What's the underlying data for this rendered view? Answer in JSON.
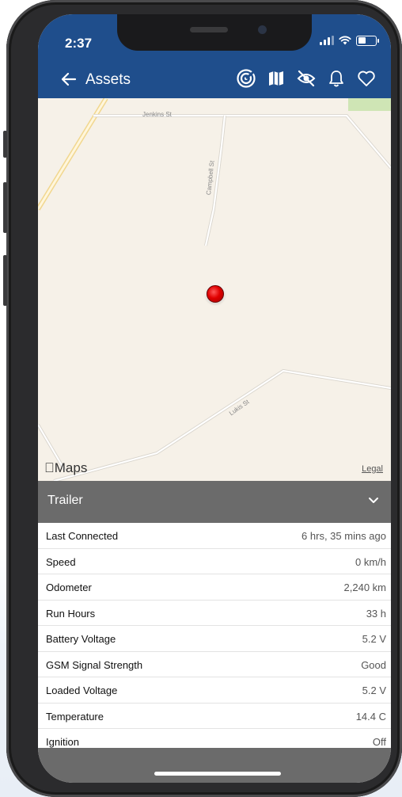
{
  "status_bar": {
    "time": "2:37"
  },
  "nav": {
    "back_label": "Assets",
    "icons": [
      "radar-icon",
      "map-icon",
      "eye-off-icon",
      "bell-icon",
      "heart-icon"
    ]
  },
  "map": {
    "streets": [
      "Jenkins St",
      "Campbell St",
      "Lukis St"
    ],
    "maps_label": "Maps",
    "legal_label": "Legal"
  },
  "panel": {
    "title": "Trailer",
    "rows": [
      {
        "label": "Last Connected",
        "value": "6 hrs, 35 mins ago"
      },
      {
        "label": "Speed",
        "value": "0 km/h"
      },
      {
        "label": "Odometer",
        "value": "2,240 km"
      },
      {
        "label": "Run Hours",
        "value": "33 h"
      },
      {
        "label": "Battery Voltage",
        "value": "5.2 V"
      },
      {
        "label": "GSM Signal Strength",
        "value": "Good"
      },
      {
        "label": "Loaded Voltage",
        "value": "5.2 V"
      },
      {
        "label": "Temperature",
        "value": "14.4 C"
      },
      {
        "label": "Ignition",
        "value": "Off"
      }
    ]
  },
  "colors": {
    "header": "#1f4e8c",
    "panel": "#6b6b6b",
    "map_bg": "#f6f1e8",
    "pin": "#e00000"
  }
}
